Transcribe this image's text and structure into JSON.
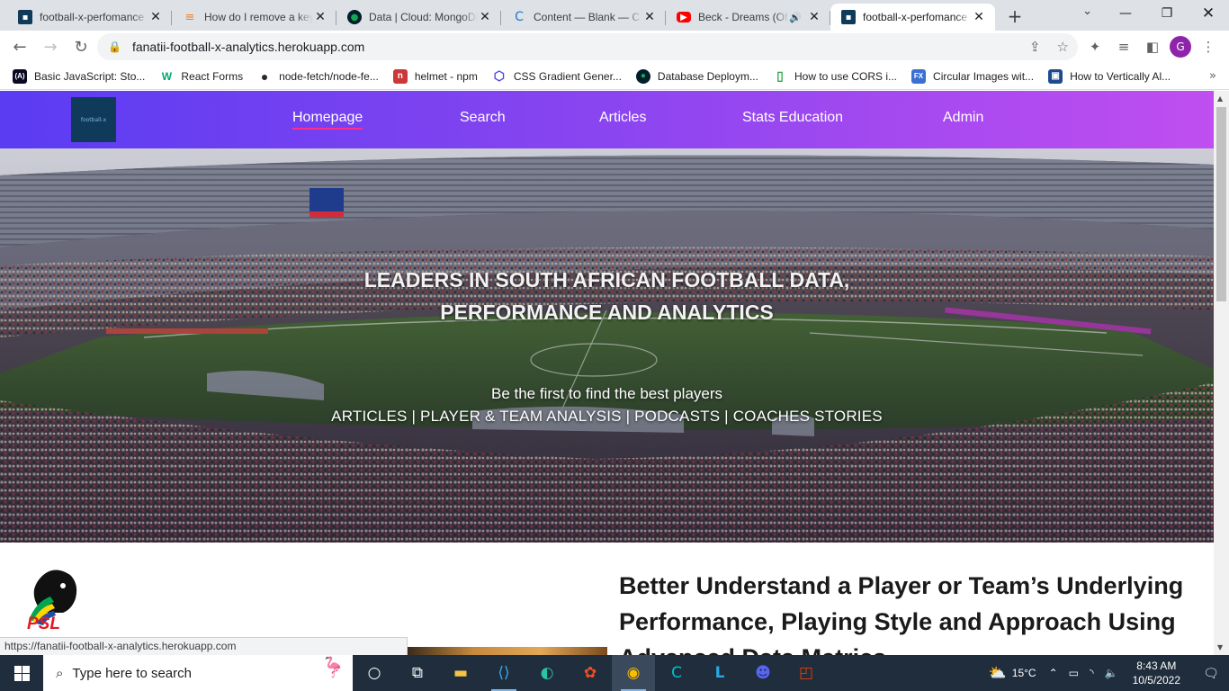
{
  "browser": {
    "tabs": [
      {
        "title": "football-x-perfomance",
        "favicon": "site-favicon",
        "color": "#0f3a5a",
        "active": false
      },
      {
        "title": "How do I remove a key",
        "favicon": "stackoverflow-favicon",
        "color": "#f48024",
        "active": false
      },
      {
        "title": "Data | Cloud: MongoDB",
        "favicon": "mongodb-favicon",
        "color": "#13aa52",
        "active": false
      },
      {
        "title": "Content — Blank — C",
        "favicon": "contentful-favicon",
        "color": "#f0b90b",
        "active": false
      },
      {
        "title": "Beck - Dreams (Of",
        "favicon": "youtube-favicon",
        "color": "#ff0000",
        "active": false,
        "audio": true
      },
      {
        "title": "football-x-perfomance",
        "favicon": "site-favicon",
        "color": "#0f3a5a",
        "active": true
      }
    ],
    "url": "fanatii-football-x-analytics.herokuapp.com",
    "profile_initial": "G",
    "bookmarks": [
      {
        "label": "Basic JavaScript: Sto...",
        "icon": "freecodecamp-icon",
        "glyph": "(A)",
        "bg": "#0a0a23",
        "fg": "#ffffff"
      },
      {
        "label": "React Forms",
        "icon": "w3schools-icon",
        "glyph": "W",
        "bg": "#ffffff",
        "fg": "#04aa6d"
      },
      {
        "label": "node-fetch/node-fe...",
        "icon": "github-icon",
        "glyph": "●",
        "bg": "#ffffff",
        "fg": "#24292f"
      },
      {
        "label": "helmet - npm",
        "icon": "npm-icon",
        "glyph": "n",
        "bg": "#cb3837",
        "fg": "#ffffff"
      },
      {
        "label": "CSS Gradient Gener...",
        "icon": "gradient-icon",
        "glyph": "⬡",
        "bg": "#ffffff",
        "fg": "#4f46e5"
      },
      {
        "label": "Database Deploym...",
        "icon": "mongodb-icon",
        "glyph": "●",
        "bg": "#ffffff",
        "fg": "#13aa52"
      },
      {
        "label": "How to use CORS i...",
        "icon": "document-icon",
        "glyph": "▯",
        "bg": "#ffffff",
        "fg": "#34a853"
      },
      {
        "label": "Circular Images wit...",
        "icon": "fx-icon",
        "glyph": "FX",
        "bg": "#3b6fd1",
        "fg": "#ffffff"
      },
      {
        "label": "How to Vertically Al...",
        "icon": "blog-icon",
        "glyph": "▣",
        "bg": "#1e4b8f",
        "fg": "#ffffff"
      }
    ]
  },
  "site": {
    "logo_text": "football-x",
    "nav": [
      "Homepage",
      "Search",
      "Articles",
      "Stats Education",
      "Admin"
    ],
    "hero": {
      "title_line1": "LEADERS IN SOUTH AFRICAN FOOTBALL DATA,",
      "title_line2": "PERFORMANCE AND ANALYTICS",
      "subtitle": "Be the first to find the best players",
      "categories": "ARTICLES | PLAYER & TEAM ANALYSIS | PODCASTS | COACHES STORIES"
    },
    "psl_logo_text": "PSL",
    "headline": "Better Understand a Player or Team’s Underlying Performance, Playing Style and Approach Using Advanced Data Metrics"
  },
  "status_url": "https://fanatii-football-x-analytics.herokuapp.com",
  "taskbar": {
    "search_placeholder": "Type here to search",
    "temperature": "15°C",
    "time": "8:43 AM",
    "date": "10/5/2022"
  },
  "colors": {
    "nav_gradient_start": "#5a3cf2",
    "nav_gradient_end": "#c04ef0",
    "nav_active_underline": "#ff2e8a",
    "taskbar_bg": "#1f2d3d"
  }
}
